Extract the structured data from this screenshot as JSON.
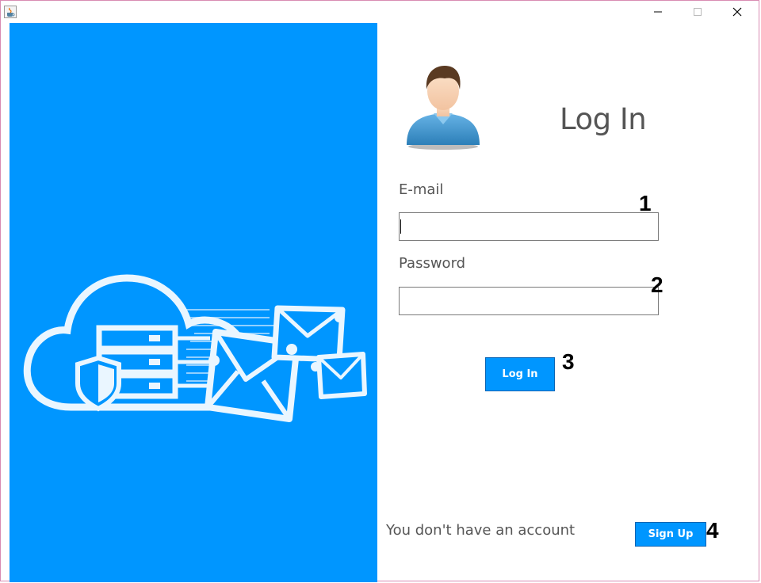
{
  "window": {
    "icon": "java-cup-icon",
    "controls": {
      "minimize": "minimize-icon",
      "maximize": "maximize-icon",
      "close": "close-icon"
    }
  },
  "colors": {
    "accent": "#0096ff",
    "text": "#555555",
    "border": "#7a7a7a"
  },
  "login": {
    "heading": "Log In",
    "email_label": "E-mail",
    "email_value": "",
    "password_label": "Password",
    "password_value": "",
    "login_button": "Log In"
  },
  "signup": {
    "prompt": "You don't have an account",
    "button": "Sign Up"
  },
  "annotations": [
    "1",
    "2",
    "3",
    "4"
  ]
}
